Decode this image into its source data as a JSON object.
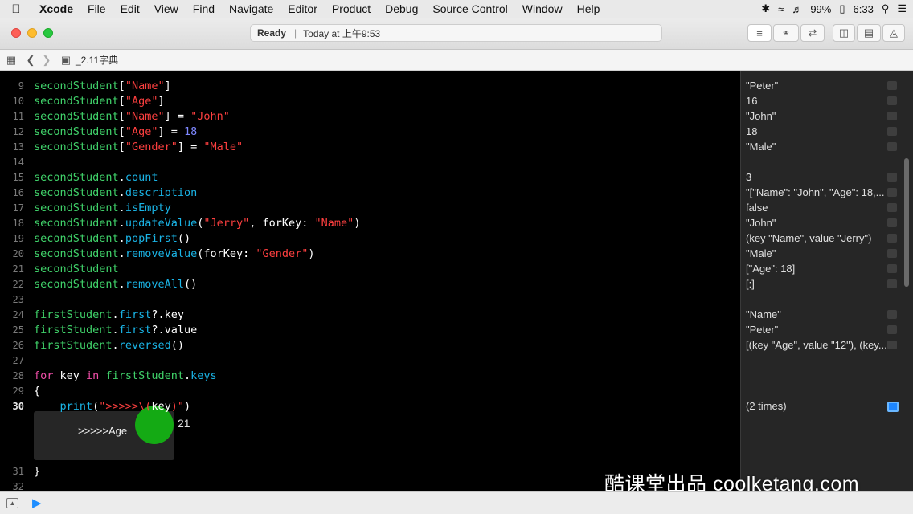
{
  "menubar": {
    "app": "Xcode",
    "items": [
      "File",
      "Edit",
      "View",
      "Find",
      "Navigate",
      "Editor",
      "Product",
      "Debug",
      "Source Control",
      "Window",
      "Help"
    ],
    "battery": "99%",
    "time": "6:33"
  },
  "toolbar": {
    "status_state": "Ready",
    "status_separator": "|",
    "status_time": "Today at 上午9:53"
  },
  "jumpbar": {
    "file": "_2.11字典"
  },
  "editor": {
    "lines": [
      {
        "num": "9",
        "tokens": [
          [
            "v",
            "secondStudent"
          ],
          [
            "t",
            "["
          ],
          [
            "s",
            "\"Name\""
          ],
          [
            "t",
            "]"
          ]
        ]
      },
      {
        "num": "10",
        "tokens": [
          [
            "v",
            "secondStudent"
          ],
          [
            "t",
            "["
          ],
          [
            "s",
            "\"Age\""
          ],
          [
            "t",
            "]"
          ]
        ]
      },
      {
        "num": "11",
        "tokens": [
          [
            "v",
            "secondStudent"
          ],
          [
            "t",
            "["
          ],
          [
            "s",
            "\"Name\""
          ],
          [
            "t",
            "] = "
          ],
          [
            "s",
            "\"John\""
          ]
        ]
      },
      {
        "num": "12",
        "tokens": [
          [
            "v",
            "secondStudent"
          ],
          [
            "t",
            "["
          ],
          [
            "s",
            "\"Age\""
          ],
          [
            "t",
            "] = "
          ],
          [
            "n",
            "18"
          ]
        ]
      },
      {
        "num": "13",
        "tokens": [
          [
            "v",
            "secondStudent"
          ],
          [
            "t",
            "["
          ],
          [
            "s",
            "\"Gender\""
          ],
          [
            "t",
            "] = "
          ],
          [
            "s",
            "\"Male\""
          ]
        ]
      },
      {
        "num": "14",
        "tokens": []
      },
      {
        "num": "15",
        "tokens": [
          [
            "v",
            "secondStudent"
          ],
          [
            "t",
            "."
          ],
          [
            "p",
            "count"
          ]
        ]
      },
      {
        "num": "16",
        "tokens": [
          [
            "v",
            "secondStudent"
          ],
          [
            "t",
            "."
          ],
          [
            "p",
            "description"
          ]
        ]
      },
      {
        "num": "17",
        "tokens": [
          [
            "v",
            "secondStudent"
          ],
          [
            "t",
            "."
          ],
          [
            "p",
            "isEmpty"
          ]
        ]
      },
      {
        "num": "18",
        "tokens": [
          [
            "v",
            "secondStudent"
          ],
          [
            "t",
            "."
          ],
          [
            "p",
            "updateValue"
          ],
          [
            "t",
            "("
          ],
          [
            "s",
            "\"Jerry\""
          ],
          [
            "t",
            ", forKey: "
          ],
          [
            "s",
            "\"Name\""
          ],
          [
            "t",
            ")"
          ]
        ]
      },
      {
        "num": "19",
        "tokens": [
          [
            "v",
            "secondStudent"
          ],
          [
            "t",
            "."
          ],
          [
            "p",
            "popFirst"
          ],
          [
            "t",
            "()"
          ]
        ]
      },
      {
        "num": "20",
        "tokens": [
          [
            "v",
            "secondStudent"
          ],
          [
            "t",
            "."
          ],
          [
            "p",
            "removeValue"
          ],
          [
            "t",
            "(forKey: "
          ],
          [
            "s",
            "\"Gender\""
          ],
          [
            "t",
            ")"
          ]
        ]
      },
      {
        "num": "21",
        "tokens": [
          [
            "v",
            "secondStudent"
          ]
        ]
      },
      {
        "num": "22",
        "tokens": [
          [
            "v",
            "secondStudent"
          ],
          [
            "t",
            "."
          ],
          [
            "p",
            "removeAll"
          ],
          [
            "t",
            "()"
          ]
        ]
      },
      {
        "num": "23",
        "tokens": []
      },
      {
        "num": "24",
        "tokens": [
          [
            "v",
            "firstStudent"
          ],
          [
            "t",
            "."
          ],
          [
            "p",
            "first"
          ],
          [
            "t",
            "?.key"
          ]
        ]
      },
      {
        "num": "25",
        "tokens": [
          [
            "v",
            "firstStudent"
          ],
          [
            "t",
            "."
          ],
          [
            "p",
            "first"
          ],
          [
            "t",
            "?.value"
          ]
        ]
      },
      {
        "num": "26",
        "tokens": [
          [
            "v",
            "firstStudent"
          ],
          [
            "t",
            "."
          ],
          [
            "p",
            "reversed"
          ],
          [
            "t",
            "()"
          ]
        ]
      },
      {
        "num": "27",
        "tokens": []
      },
      {
        "num": "28",
        "tokens": [
          [
            "k",
            "for"
          ],
          [
            "t",
            " key "
          ],
          [
            "k",
            "in"
          ],
          [
            "t",
            " "
          ],
          [
            "v",
            "firstStudent"
          ],
          [
            "t",
            "."
          ],
          [
            "p",
            "keys"
          ]
        ]
      },
      {
        "num": "29",
        "tokens": [
          [
            "t",
            "{"
          ]
        ]
      },
      {
        "num": "30",
        "tokens": [
          [
            "t",
            "    "
          ],
          [
            "p",
            "print"
          ],
          [
            "t",
            "("
          ],
          [
            "s",
            "\">>>>>\\("
          ],
          [
            "t",
            "key"
          ],
          [
            "s",
            ")\""
          ],
          [
            "t",
            ")"
          ]
        ]
      },
      {
        "num": "31",
        "tokens": [
          [
            "t",
            "}"
          ]
        ]
      },
      {
        "num": "32",
        "tokens": []
      }
    ],
    "current_line": "30",
    "console_output": ">>>>>Age",
    "console_side_value": "21"
  },
  "results": [
    {
      "line": "9",
      "text": "\"Peter\""
    },
    {
      "line": "10",
      "text": "16"
    },
    {
      "line": "11",
      "text": "\"John\""
    },
    {
      "line": "12",
      "text": "18"
    },
    {
      "line": "13",
      "text": "\"Male\""
    },
    {
      "line": "15",
      "text": "3"
    },
    {
      "line": "16",
      "text": "\"[\"Name\": \"John\", \"Age\": 18,..."
    },
    {
      "line": "17",
      "text": "false"
    },
    {
      "line": "18",
      "text": "\"John\""
    },
    {
      "line": "19",
      "text": "(key \"Name\", value \"Jerry\")"
    },
    {
      "line": "20",
      "text": "\"Male\""
    },
    {
      "line": "21",
      "text": "[\"Age\": 18]"
    },
    {
      "line": "22",
      "text": "[:]"
    },
    {
      "line": "24",
      "text": "\"Name\""
    },
    {
      "line": "25",
      "text": "\"Peter\""
    },
    {
      "line": "26",
      "text": "[(key \"Age\", value \"12\"), (key..."
    },
    {
      "line": "30",
      "text": "(2 times)"
    }
  ],
  "watermark": "酷课堂出品 coolketang.com"
}
